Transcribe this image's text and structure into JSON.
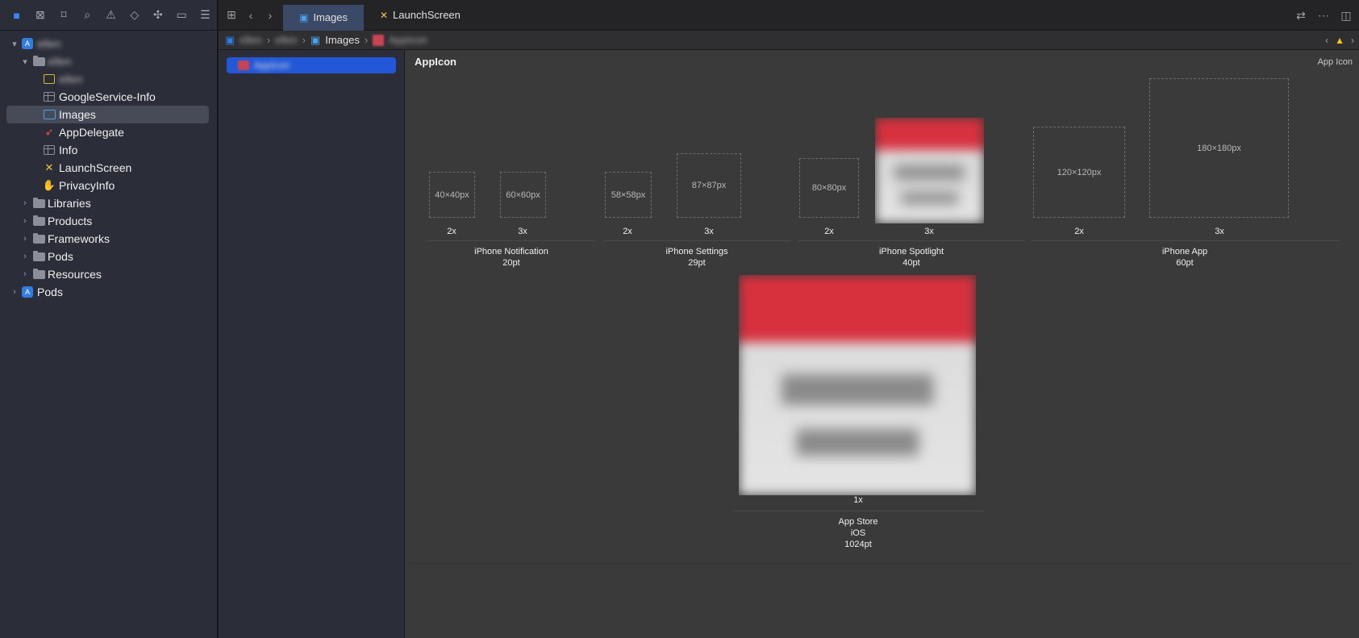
{
  "navigator": {
    "toolbar_icons": [
      "folder-icon",
      "source-control-icon",
      "bookmark-icon",
      "find-icon",
      "issue-icon",
      "test-icon",
      "debug-icon",
      "breakpoint-icon",
      "report-icon"
    ],
    "items": [
      {
        "label": "ellen",
        "blurred": true,
        "kind": "project",
        "level": 0,
        "disclosure": "▾"
      },
      {
        "label": "ellen",
        "blurred": true,
        "kind": "folder",
        "level": 1,
        "disclosure": "▾"
      },
      {
        "label": "ellen",
        "blurred": true,
        "kind": "entitlements",
        "level": 2,
        "disclosure": ""
      },
      {
        "label": "GoogleService-Info",
        "blurred": false,
        "kind": "plist",
        "level": 2,
        "disclosure": ""
      },
      {
        "label": "Images",
        "blurred": false,
        "kind": "assets",
        "level": 2,
        "disclosure": "",
        "selected": true
      },
      {
        "label": "AppDelegate",
        "blurred": false,
        "kind": "swift",
        "level": 2,
        "disclosure": ""
      },
      {
        "label": "Info",
        "blurred": false,
        "kind": "plist",
        "level": 2,
        "disclosure": ""
      },
      {
        "label": "LaunchScreen",
        "blurred": false,
        "kind": "xib",
        "level": 2,
        "disclosure": ""
      },
      {
        "label": "PrivacyInfo",
        "blurred": false,
        "kind": "privacy",
        "level": 2,
        "disclosure": ""
      },
      {
        "label": "Libraries",
        "blurred": false,
        "kind": "folder",
        "level": 1,
        "disclosure": "›"
      },
      {
        "label": "Products",
        "blurred": false,
        "kind": "folder",
        "level": 1,
        "disclosure": "›"
      },
      {
        "label": "Frameworks",
        "blurred": false,
        "kind": "folder",
        "level": 1,
        "disclosure": "›"
      },
      {
        "label": "Pods",
        "blurred": false,
        "kind": "folder",
        "level": 1,
        "disclosure": "›"
      },
      {
        "label": "Resources",
        "blurred": false,
        "kind": "folder",
        "level": 1,
        "disclosure": "›"
      },
      {
        "label": "Pods",
        "blurred": false,
        "kind": "project",
        "level": 0,
        "disclosure": "›"
      }
    ]
  },
  "tabs": [
    {
      "label": "Images",
      "icon": "assets-icon",
      "active": true
    },
    {
      "label": "LaunchScreen",
      "icon": "xib-icon",
      "active": false
    }
  ],
  "pathbar": {
    "crumbs_blurred_1": "ellen",
    "crumbs_blurred_2": "ellen",
    "images": "Images",
    "appicon_blurred": "AppIcon"
  },
  "setlist": {
    "selected_item": "AppIcon"
  },
  "iconpane": {
    "title": "AppIcon",
    "kind": "App Icon",
    "slots": [
      {
        "size": "40×40px",
        "scale": "2x"
      },
      {
        "size": "60×60px",
        "scale": "3x"
      },
      {
        "size": "58×58px",
        "scale": "2x"
      },
      {
        "size": "87×87px",
        "scale": "3x"
      },
      {
        "size": "80×80px",
        "scale": "2x"
      },
      {
        "size": "",
        "scale": "3x"
      },
      {
        "size": "120×120px",
        "scale": "2x"
      },
      {
        "size": "180×180px",
        "scale": "3x"
      },
      {
        "size": "",
        "scale": "1x"
      }
    ],
    "groups": [
      {
        "line1": "iPhone Notification",
        "line2": "20pt",
        "line3": ""
      },
      {
        "line1": "iPhone Settings",
        "line2": "29pt",
        "line3": ""
      },
      {
        "line1": "iPhone Spotlight",
        "line2": "40pt",
        "line3": ""
      },
      {
        "line1": "iPhone App",
        "line2": "60pt",
        "line3": ""
      },
      {
        "line1": "App Store",
        "line2": "iOS",
        "line3": "1024pt"
      }
    ]
  }
}
